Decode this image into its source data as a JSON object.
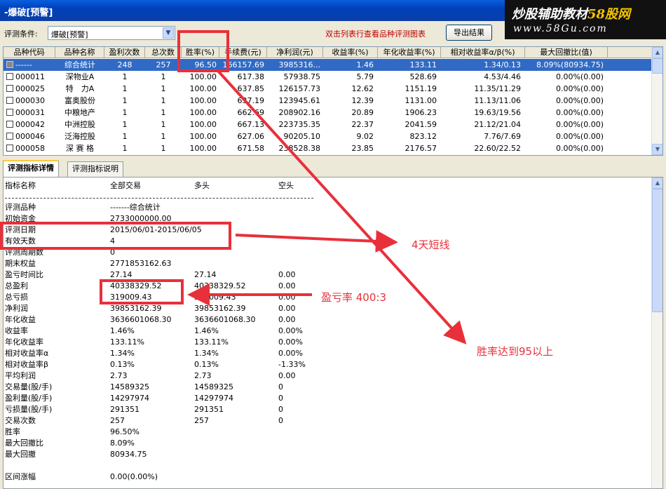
{
  "window": {
    "title": "-爆破[预警]"
  },
  "brand": {
    "line1_prefix": "炒股辅助教材",
    "line1_accent": "58股网",
    "line2": "www.58Gu.com"
  },
  "toolbar": {
    "condition_label": "评测条件:",
    "condition_value": "爆破[预警]",
    "hint": "双击列表行查看品种评测图表",
    "export_label": "导出结果"
  },
  "table": {
    "columns": [
      "品种代码",
      "品种名称",
      "盈利次数",
      "总次数",
      "胜率(%)",
      "手续费(元)",
      "净利润(元)",
      "收益率(%)",
      "年化收益率(%)",
      "相对收益率α/β(%)",
      "最大回撤比(值)"
    ],
    "rows": [
      {
        "code": "------",
        "name": "综合统计",
        "wins": "248",
        "total": "257",
        "win_rate": "96.50",
        "fee": "166157.69",
        "net_profit": "3985316...",
        "return": "1.46",
        "annual": "133.11",
        "alpha_beta": "1.34/0.13",
        "max_dd": "8.09%(80934.75)",
        "selected": true
      },
      {
        "code": "000011",
        "name": "深物业A",
        "wins": "1",
        "total": "1",
        "win_rate": "100.00",
        "fee": "617.38",
        "net_profit": "57938.75",
        "return": "5.79",
        "annual": "528.69",
        "alpha_beta": "4.53/4.46",
        "max_dd": "0.00%(0.00)"
      },
      {
        "code": "000025",
        "name": "特　力A",
        "wins": "1",
        "total": "1",
        "win_rate": "100.00",
        "fee": "637.85",
        "net_profit": "126157.73",
        "return": "12.62",
        "annual": "1151.19",
        "alpha_beta": "11.35/11.29",
        "max_dd": "0.00%(0.00)"
      },
      {
        "code": "000030",
        "name": "富奥股份",
        "wins": "1",
        "total": "1",
        "win_rate": "100.00",
        "fee": "637.19",
        "net_profit": "123945.61",
        "return": "12.39",
        "annual": "1131.00",
        "alpha_beta": "11.13/11.06",
        "max_dd": "0.00%(0.00)"
      },
      {
        "code": "000031",
        "name": "中粮地产",
        "wins": "1",
        "total": "1",
        "win_rate": "100.00",
        "fee": "662.69",
        "net_profit": "208902.16",
        "return": "20.89",
        "annual": "1906.23",
        "alpha_beta": "19.63/19.56",
        "max_dd": "0.00%(0.00)"
      },
      {
        "code": "000042",
        "name": "中洲控股",
        "wins": "1",
        "total": "1",
        "win_rate": "100.00",
        "fee": "667.13",
        "net_profit": "223735.35",
        "return": "22.37",
        "annual": "2041.59",
        "alpha_beta": "21.12/21.04",
        "max_dd": "0.00%(0.00)"
      },
      {
        "code": "000046",
        "name": "泛海控股",
        "wins": "1",
        "total": "1",
        "win_rate": "100.00",
        "fee": "627.06",
        "net_profit": "90205.10",
        "return": "9.02",
        "annual": "823.12",
        "alpha_beta": "7.76/7.69",
        "max_dd": "0.00%(0.00)"
      },
      {
        "code": "000058",
        "name": "深 赛 格",
        "wins": "1",
        "total": "1",
        "win_rate": "100.00",
        "fee": "671.58",
        "net_profit": "238528.38",
        "return": "23.85",
        "annual": "2176.57",
        "alpha_beta": "22.60/22.52",
        "max_dd": "0.00%(0.00)"
      }
    ]
  },
  "tabs": [
    "评测指标详情",
    "评测指标说明"
  ],
  "detail": {
    "headers": [
      "指标名称",
      "全部交易",
      "多头",
      "空头"
    ],
    "rows": [
      [
        "评测品种",
        "-------综合统计",
        "",
        ""
      ],
      [
        "初始资金",
        "2733000000.00",
        "",
        ""
      ],
      [
        "评测日期",
        "2015/06/01-2015/06/05",
        "",
        ""
      ],
      [
        "有效天数",
        "4",
        "",
        ""
      ],
      [
        "评测周期数",
        "0",
        "",
        ""
      ],
      [
        "期末权益",
        "2771853162.63",
        "",
        ""
      ],
      [
        "盈亏时间比",
        "27.14",
        "27.14",
        "0.00"
      ],
      [
        "总盈利",
        "40338329.52",
        "40338329.52",
        "0.00"
      ],
      [
        "总亏损",
        "319009.43",
        "319009.43",
        "0.00"
      ],
      [
        "净利润",
        "39853162.39",
        "39853162.39",
        "0.00"
      ],
      [
        "年化收益",
        "3636601068.30",
        "3636601068.30",
        "0.00"
      ],
      [
        "收益率",
        "1.46%",
        "1.46%",
        "0.00%"
      ],
      [
        "年化收益率",
        "133.11%",
        "133.11%",
        "0.00%"
      ],
      [
        "相对收益率α",
        "1.34%",
        " 1.34%",
        " 0.00%"
      ],
      [
        "相对收益率β",
        "0.13%",
        " 0.13%",
        " -1.33%"
      ],
      [
        "平均利润",
        "2.73",
        "2.73",
        "0.00"
      ],
      [
        "交易量(股/手)",
        "14589325",
        "14589325",
        "0"
      ],
      [
        "盈利量(股/手)",
        "14297974",
        "14297974",
        "0"
      ],
      [
        "亏损量(股/手)",
        "291351",
        "291351",
        "0"
      ],
      [
        "交易次数",
        "257",
        "257",
        "0"
      ],
      [
        "胜率",
        "96.50%",
        "",
        ""
      ],
      [
        "最大回撤比",
        "8.09%",
        "",
        ""
      ],
      [
        "最大回撤",
        "80934.75",
        "",
        ""
      ],
      [
        "",
        "",
        "",
        ""
      ],
      [
        "区间涨幅",
        "0.00(0.00%)",
        "",
        ""
      ]
    ]
  },
  "annotations": {
    "short_term": "4天短线",
    "profit_loss_ratio": "盈亏率 400:3",
    "win_rate_note": "胜率达到95以上",
    "color": "#e8303a"
  }
}
